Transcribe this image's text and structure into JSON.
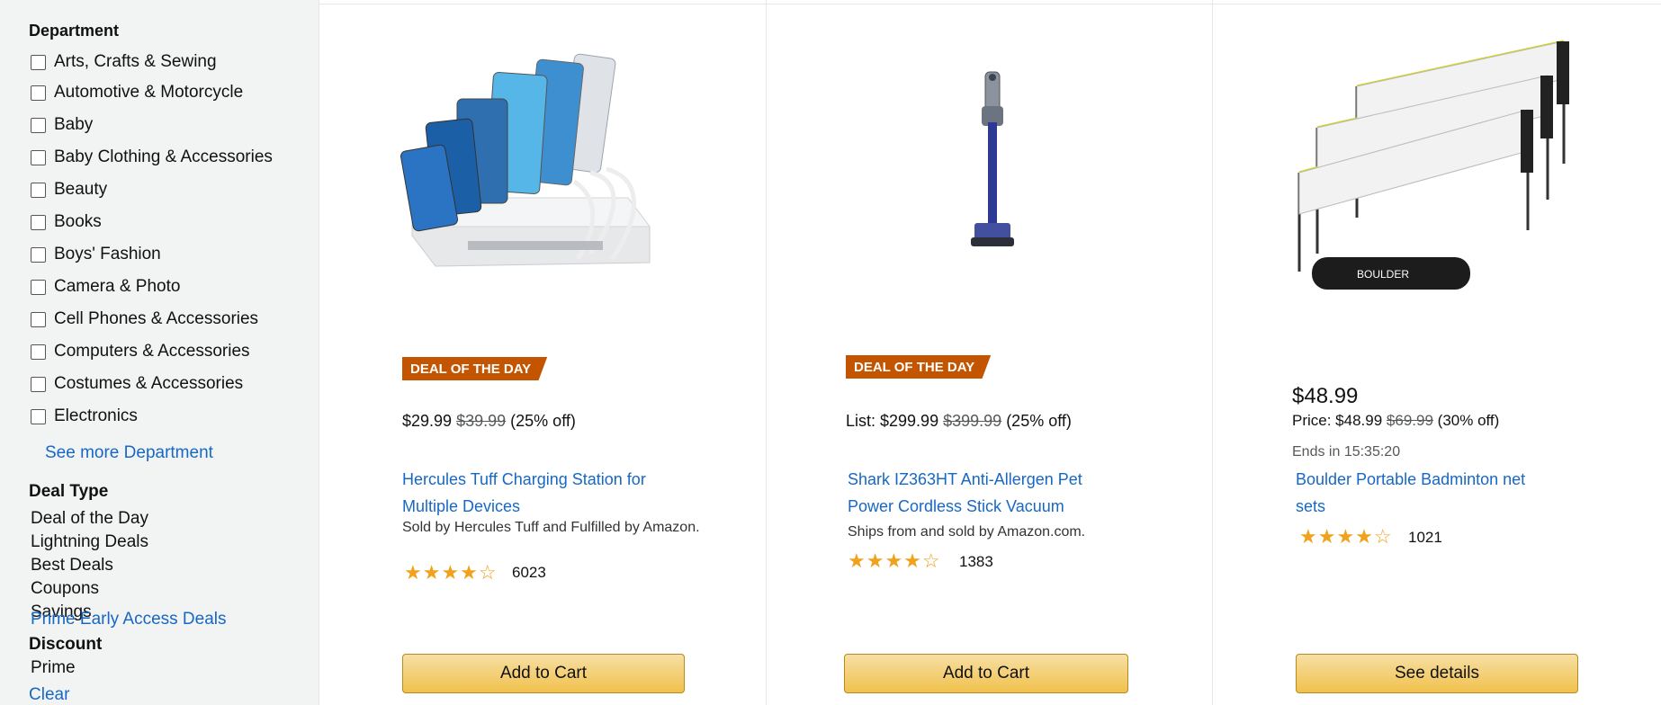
{
  "sidebar": {
    "department_heading": "Department",
    "departments": [
      "Arts, Crafts & Sewing",
      "Automotive & Motorcycle",
      "Baby",
      "Baby Clothing & Accessories",
      "Beauty",
      "Books",
      "Boys' Fashion",
      "Camera & Photo",
      "Cell Phones & Accessories",
      "Computers & Accessories",
      "Costumes & Accessories",
      "Electronics"
    ],
    "see_more": "See more Department",
    "deal_type_heading": "Deal Type",
    "deal_types": [
      "Deal of the Day",
      "Lightning Deals",
      "Best Deals",
      "Coupons",
      "Savings"
    ],
    "prime_link": "Prime Early Access Deals",
    "filters_heading": "Discount",
    "filter_label": "Prime",
    "clear_link": "Clear"
  },
  "products": [
    {
      "badge": "DEAL OF THE DAY",
      "price_text": "$29.99",
      "list_price": "$39.99",
      "discount": "(25% off)",
      "title": "Hercules Tuff Charging Station for Multiple Devices",
      "sold_by": "Sold by Hercules Tuff and Fulfilled by Amazon.",
      "stars": "★★★★☆",
      "rating_count": "6023",
      "button": "Add to Cart"
    },
    {
      "badge": "DEAL OF THE DAY",
      "price_text": "List: $299.99",
      "list_price": "$399.99",
      "discount": "(25% off)",
      "title": "Shark IZ363HT Anti-Allergen Pet Power Cordless Stick Vacuum",
      "sold_by": "Ships from and sold by Amazon.com.",
      "stars": "★★★★☆",
      "rating_count": "1383",
      "button": "Add to Cart"
    },
    {
      "badge": "",
      "price_main": "$48.99",
      "price_text": "Price: $48.99",
      "list_price": "$69.99",
      "discount": "(30% off)",
      "ends_in": "Ends in 15:35:20",
      "title": "Boulder Portable Badminton net sets",
      "stars": "★★★★☆",
      "rating_count": "1021",
      "button": "See details"
    }
  ]
}
